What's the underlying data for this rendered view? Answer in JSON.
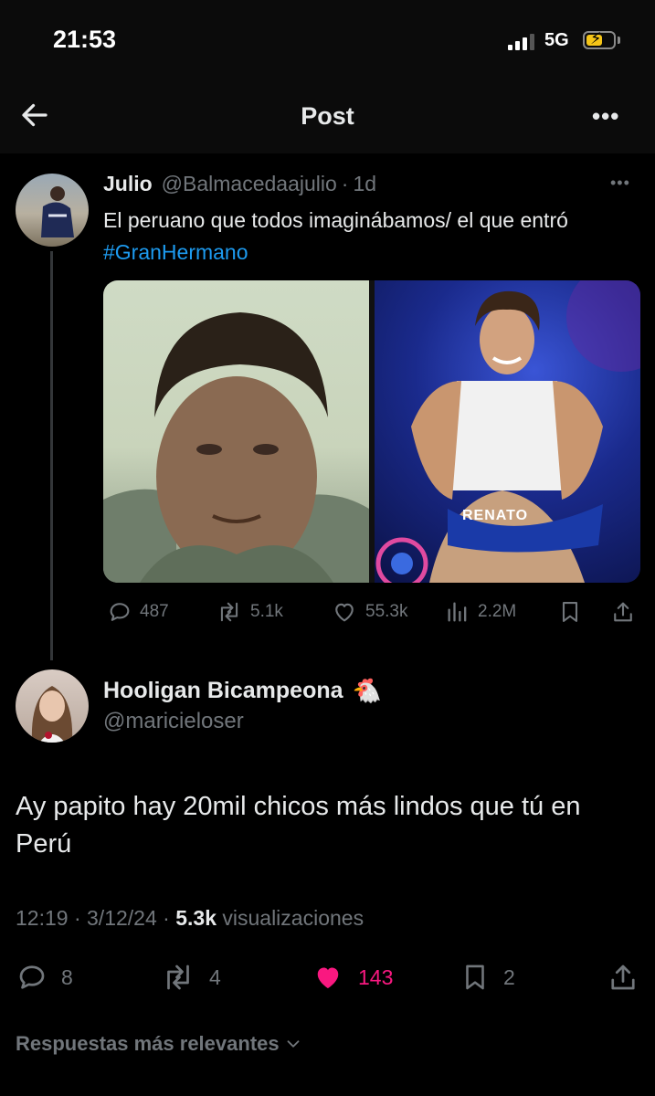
{
  "status_bar": {
    "time": "21:53",
    "network": "5G"
  },
  "nav": {
    "title": "Post"
  },
  "quoted_post": {
    "author_name": "Julio",
    "author_handle": "@Balmacedaajulio",
    "separator": "·",
    "age": "1d",
    "text_main": "El peruano que todos imaginábamos/ el que entró ",
    "hashtag": "#GranHermano",
    "image_right_label": "RENATO",
    "stats": {
      "replies": "487",
      "reposts": "5.1k",
      "likes": "55.3k",
      "views": "2.2M"
    }
  },
  "main_post": {
    "author_name": "Hooligan Bicampeona",
    "author_emoji": "🐔",
    "author_handle": "@maricieloser",
    "text": "Ay papito hay 20mil chicos más lindos que tú en Perú",
    "time": "12:19",
    "date": "3/12/24",
    "sep": "·",
    "views_count": "5.3k",
    "views_label": "visualizaciones",
    "stats": {
      "replies": "8",
      "reposts": "4",
      "likes": "143",
      "bookmarks": "2"
    }
  },
  "replies_filter": {
    "label": "Respuestas más relevantes"
  },
  "colors": {
    "accent": "#1d9bf0",
    "like": "#f91880",
    "muted": "#71767b"
  }
}
